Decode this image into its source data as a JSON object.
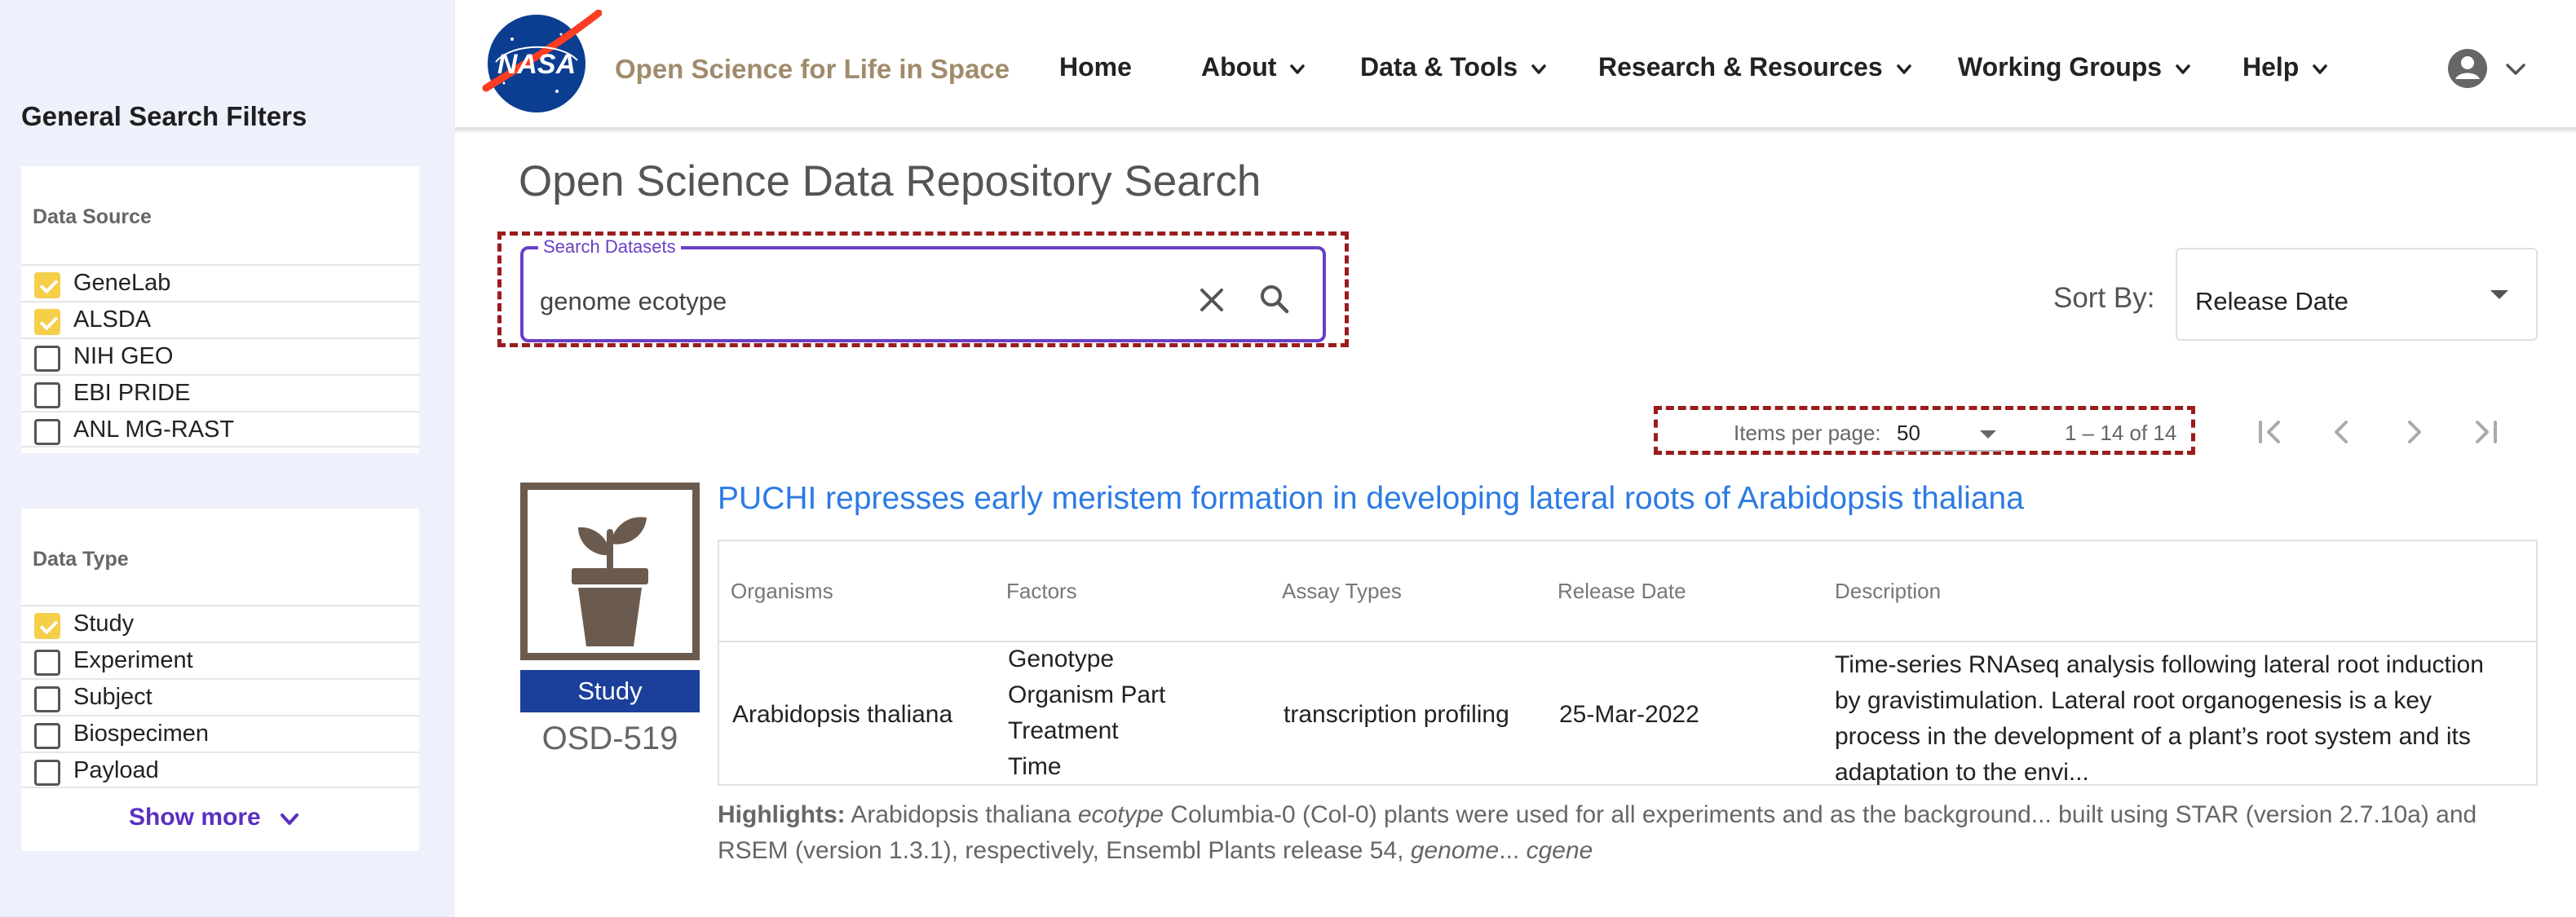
{
  "sidebar": {
    "title": "General Search Filters",
    "data_source": {
      "title": "Data Source",
      "options": [
        {
          "label": "GeneLab",
          "checked": true
        },
        {
          "label": "ALSDA",
          "checked": true
        },
        {
          "label": "NIH GEO",
          "checked": false
        },
        {
          "label": "EBI PRIDE",
          "checked": false
        },
        {
          "label": "ANL MG-RAST",
          "checked": false
        }
      ]
    },
    "data_type": {
      "title": "Data Type",
      "options": [
        {
          "label": "Study",
          "checked": true
        },
        {
          "label": "Experiment",
          "checked": false
        },
        {
          "label": "Subject",
          "checked": false
        },
        {
          "label": "Biospecimen",
          "checked": false
        },
        {
          "label": "Payload",
          "checked": false
        }
      ],
      "show_more": "Show more"
    }
  },
  "header": {
    "logo_text": "NASA",
    "site_title": "Open Science for Life in Space",
    "nav": [
      {
        "label": "Home",
        "has_dropdown": false
      },
      {
        "label": "About",
        "has_dropdown": true
      },
      {
        "label": "Data & Tools",
        "has_dropdown": true
      },
      {
        "label": "Research & Resources",
        "has_dropdown": true
      },
      {
        "label": "Working Groups",
        "has_dropdown": true
      },
      {
        "label": "Help",
        "has_dropdown": true
      }
    ]
  },
  "main": {
    "page_title": "Open Science Data Repository Search",
    "search": {
      "legend": "Search Datasets",
      "value": "genome ecotype"
    },
    "sort": {
      "label": "Sort By:",
      "value": "Release Date"
    },
    "pagination": {
      "items_per_page_label": "Items per page:",
      "items_per_page": "50",
      "range": "1 – 14 of 14"
    }
  },
  "result": {
    "type_badge": "Study",
    "id": "OSD-519",
    "title": "PUCHI represses early meristem formation in developing lateral roots of Arabidopsis thaliana",
    "columns": [
      "Organisms",
      "Factors",
      "Assay Types",
      "Release Date",
      "Description"
    ],
    "organism": "Arabidopsis thaliana",
    "factors": [
      "Genotype",
      "Organism Part",
      "Treatment",
      "Time"
    ],
    "assay_type": "transcription profiling",
    "release_date": "25-Mar-2022",
    "description": "Time-series RNAseq analysis following lateral root induction by gravistimulation. Lateral root organogenesis is a key process in the development of a plant’s root system and its adaptation to the envi...",
    "highlights_label": "Highlights:",
    "highlights": {
      "part1": "Arabidopsis thaliana",
      "part2": "ecotype",
      "part3": "Columbia-0 (Col-0) plants were used for all experiments and as the background... built using STAR (version 2.7.10a) and RSEM (version 1.3.1), respectively, Ensembl Plants release 54,",
      "part4": "genome",
      "part5": "...",
      "part6": "cgene"
    }
  },
  "colors": {
    "accent_purple": "#6a3fc6",
    "link_blue": "#2c7be5",
    "checkbox_yellow": "#f5cf4a",
    "badge_blue": "#1b3f9a",
    "annotation_red": "#9b1c1c"
  }
}
